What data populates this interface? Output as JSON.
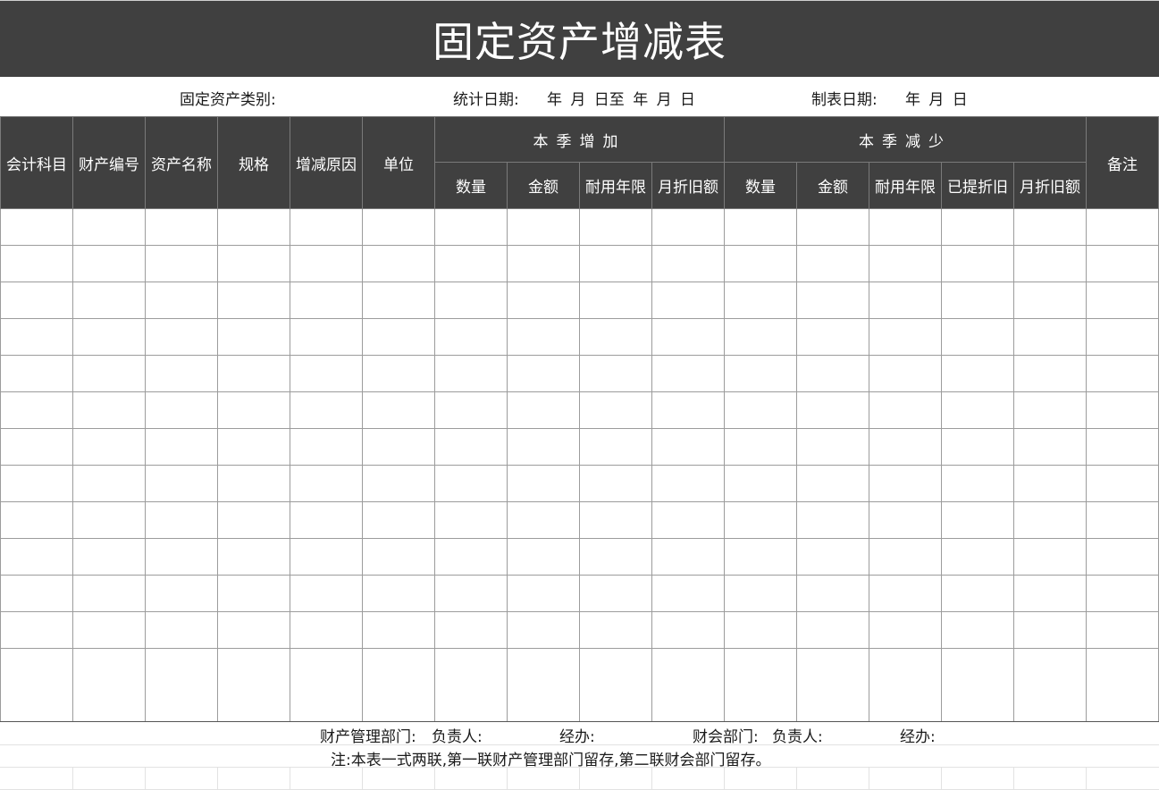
{
  "title": "固定资产增减表",
  "info": {
    "category_label": "固定资产类别:",
    "stat_date_label": "统计日期:",
    "stat_date_value": "年  月  日至  年  月  日",
    "made_date_label": "制表日期:",
    "made_date_value": "年  月  日"
  },
  "headers": {
    "account": "会计科目",
    "asset_no": "财产编号",
    "asset_name": "资产名称",
    "spec": "规格",
    "reason": "增减原因",
    "unit": "单位",
    "increase_group": "本季增加",
    "decrease_group": "本季减少",
    "remark": "备注",
    "increase_cols": [
      "数量",
      "金额",
      "耐用年限",
      "月折旧额"
    ],
    "decrease_cols": [
      "数量",
      "金额",
      "耐用年限",
      "已提折旧",
      "月折旧额"
    ]
  },
  "footer": {
    "dept_label": "财产管理部门:",
    "dept_head": "负责人:",
    "dept_handler": "经办:",
    "finance_label": "财会部门:",
    "finance_head": "负责人:",
    "finance_handler": "经办:",
    "note": "注:本表一式两联,第一联财产管理部门留存,第二联财会部门留存。"
  }
}
